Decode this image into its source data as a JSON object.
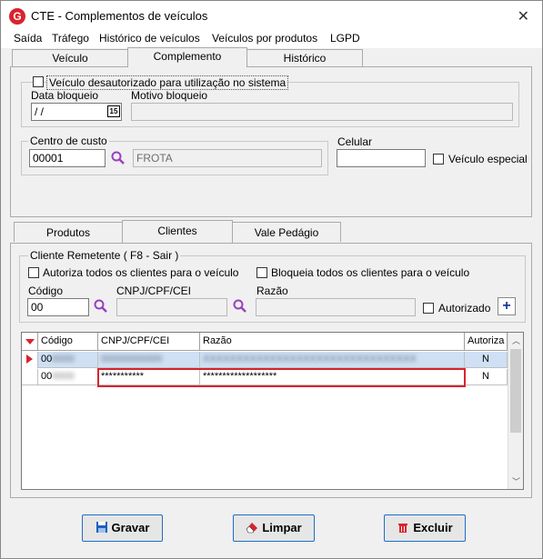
{
  "window": {
    "title": "CTE - Complementos de veículos",
    "close_glyph": "✕"
  },
  "menu": [
    "Saída",
    "Tráfego",
    "Histórico de veículos",
    "Veículos por produtos",
    "LGPD"
  ],
  "top_tabs": [
    "Veículo",
    "Complemento",
    "Histórico"
  ],
  "bloqueio": {
    "group_label": "Veículo desautorizado para utilização no sistema",
    "data_label": "Data bloqueio",
    "data_value": " /  /",
    "calendar_icon_text": "15",
    "motivo_label": "Motivo bloqueio",
    "motivo_value": ""
  },
  "centro_custo": {
    "group_label": "Centro de custo",
    "code": "00001",
    "name": "FROTA"
  },
  "celular": {
    "label": "Celular",
    "value": ""
  },
  "veiculo_especial": {
    "label": "Veículo especial",
    "checked": false
  },
  "mid_tabs": [
    "Produtos",
    "Clientes",
    "Vale Pedágio"
  ],
  "cliente": {
    "group_label": "Cliente Remetente ( F8 - Sair )",
    "autoriza_label": "Autoriza todos os clientes para o veículo",
    "bloqueia_label": "Bloqueia todos os clientes para o veículo",
    "codigo_label": "Código",
    "codigo_value": "00",
    "cnpj_label": "CNPJ/CPF/CEI",
    "cnpj_value": "",
    "razao_label": "Razão",
    "razao_value": "",
    "autorizado_label": "Autorizado",
    "add_glyph": "+"
  },
  "grid": {
    "columns": [
      "Código",
      "CNPJ/CPF/CEI",
      "Razão",
      "Autoriza"
    ],
    "rows": [
      {
        "codigo": "00",
        "cnpj": "",
        "razao": "",
        "autoriza": "N"
      },
      {
        "codigo": "00",
        "cnpj": "***********",
        "razao": "*******************",
        "autoriza": "N"
      }
    ]
  },
  "buttons": {
    "gravar": "Gravar",
    "limpar": "Limpar",
    "excluir": "Excluir"
  },
  "colors": {
    "accent": "#1e6ec8",
    "highlight_border": "#d9232d",
    "selected_row": "#cfe0f5",
    "app_icon": "#d9232d"
  }
}
